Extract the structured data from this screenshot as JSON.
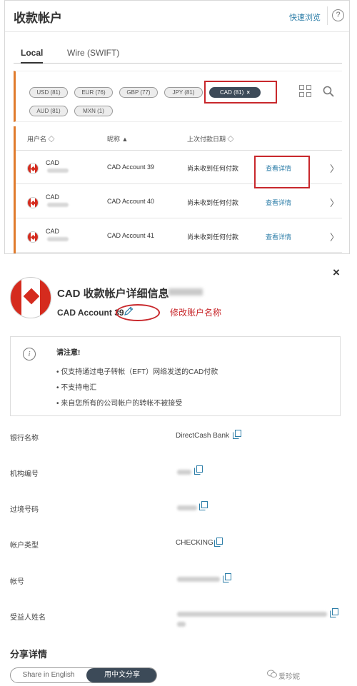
{
  "top": {
    "title": "收款帐户",
    "quick_browse": "快速浏览",
    "help_glyph": "?",
    "tabs": [
      "Local",
      "Wire (SWIFT)"
    ],
    "chips": [
      "USD (81)",
      "EUR (76)",
      "GBP (77)",
      "JPY (81)",
      "CAD (81)",
      "AUD (81)",
      "MXN (1)"
    ],
    "selected_chip_close": "×",
    "columns": [
      "用户名 ◇",
      "昵称 ▲",
      "上次付款日期 ◇"
    ],
    "rows": [
      {
        "currency": "CAD",
        "nickname": "CAD Account 39",
        "last_payment": "尚未收到任何付款",
        "link": "查看详情"
      },
      {
        "currency": "CAD",
        "nickname": "CAD Account 40",
        "last_payment": "尚未收到任何付款",
        "link": "查看详情"
      },
      {
        "currency": "CAD",
        "nickname": "CAD Account 41",
        "last_payment": "尚未收到任何付款",
        "link": "查看详情"
      }
    ],
    "chevron": "〉"
  },
  "detail": {
    "close": "×",
    "title": "CAD 收款帐户详细信息",
    "account_name": "CAD Account 39",
    "annotation": "修改账户名称",
    "notice": {
      "icon": "i",
      "title": "请注意!",
      "items": [
        "• 仅支持通过电子转帐（EFT）网络发送的CAD付款",
        "• 不支持电汇",
        "• 来自您所有的公司帐户的转帐不被接受"
      ]
    },
    "fields": [
      {
        "label": "银行名称",
        "value": "DirectCash Bank"
      },
      {
        "label": "机构编号",
        "value": ""
      },
      {
        "label": "过境号码",
        "value": ""
      },
      {
        "label": "帐户类型",
        "value": "CHECKING"
      },
      {
        "label": "帐号",
        "value": ""
      },
      {
        "label": "受益人姓名",
        "value": ""
      }
    ],
    "share_title": "分享详情",
    "share_english": "Share in English",
    "share_chinese": "用中文分享",
    "watermark": "爱珍妮"
  },
  "colors": {
    "accent_orange": "#e07b2c",
    "link_blue": "#2d7ea8",
    "selected_dark": "#3c4a58",
    "annotation_red": "#c8282c",
    "flag_red": "#d52b1e"
  },
  "icons": [
    "help-icon",
    "grid-view-icon",
    "search-icon",
    "canada-flag-icon",
    "chevron-right-icon",
    "close-icon",
    "pencil-icon",
    "info-icon",
    "copy-icon",
    "wechat-icon"
  ]
}
